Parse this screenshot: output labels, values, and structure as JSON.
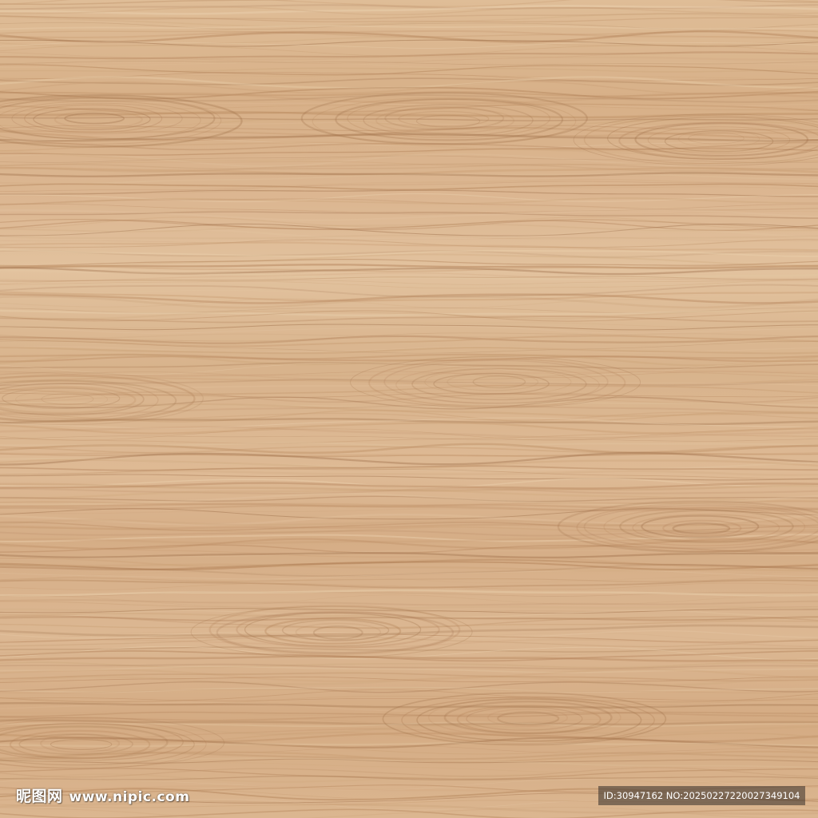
{
  "watermark": {
    "logo_text": "昵图网",
    "site": "www.nipic.com",
    "id_line": "ID:30947162 NO:20250227220027349104"
  },
  "colors": {
    "base": "#d9b48e",
    "light": "#ecd2b0",
    "mid": "#c99e74",
    "dark": "#b07e55",
    "darker": "#9c6c46"
  },
  "description_icon": "wood-grain-texture"
}
